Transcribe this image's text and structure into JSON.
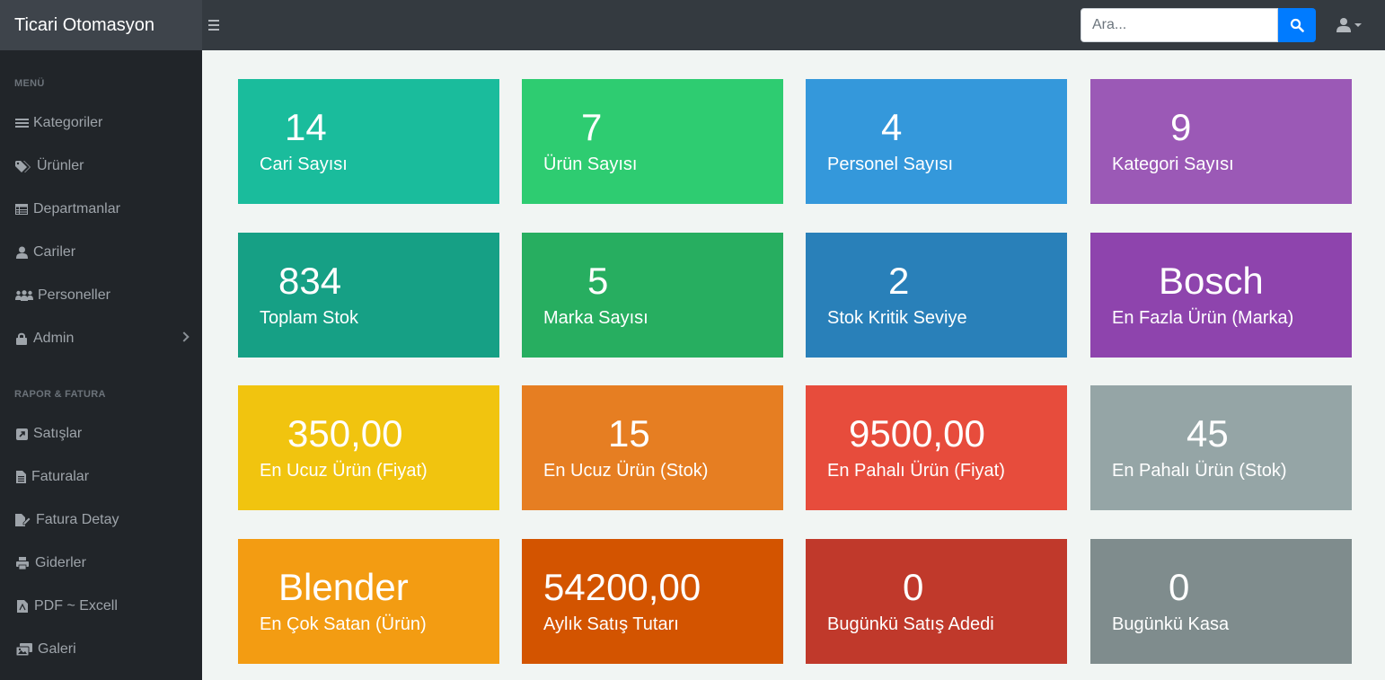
{
  "app": {
    "title": "Ticari Otomasyon"
  },
  "search": {
    "placeholder": "Ara..."
  },
  "icons": {
    "menu_toggle": "bars-icon",
    "search": "search-icon",
    "user": "user-icon"
  },
  "sidebar": {
    "sections": [
      {
        "heading": "MENÜ",
        "items": [
          {
            "label": "Kategoriler",
            "icon": "list-icon"
          },
          {
            "label": "Ürünler",
            "icon": "tags-icon"
          },
          {
            "label": "Departmanlar",
            "icon": "table-icon"
          },
          {
            "label": "Cariler",
            "icon": "user-icon"
          },
          {
            "label": "Personeller",
            "icon": "users-icon"
          },
          {
            "label": "Admin",
            "icon": "lock-icon",
            "has_submenu": true
          }
        ]
      },
      {
        "heading": "RAPOR & FATURA",
        "items": [
          {
            "label": "Satışlar",
            "icon": "external-link-icon"
          },
          {
            "label": "Faturalar",
            "icon": "file-text-icon"
          },
          {
            "label": "Fatura Detay",
            "icon": "edit-file-icon"
          },
          {
            "label": "Giderler",
            "icon": "print-icon"
          },
          {
            "label": "PDF ~ Excell",
            "icon": "pdf-file-icon"
          },
          {
            "label": "Galeri",
            "icon": "images-icon"
          }
        ]
      }
    ]
  },
  "cards": [
    {
      "value": "14",
      "label": "Cari Sayısı",
      "color": "#1abc9c"
    },
    {
      "value": "7",
      "label": "Ürün Sayısı",
      "color": "#2ecc71"
    },
    {
      "value": "4",
      "label": "Personel Sayısı",
      "color": "#3498db"
    },
    {
      "value": "9",
      "label": "Kategori Sayısı",
      "color": "#9b59b6"
    },
    {
      "value": "834",
      "label": "Toplam Stok",
      "color": "#16a085"
    },
    {
      "value": "5",
      "label": "Marka Sayısı",
      "color": "#27ae60"
    },
    {
      "value": "2",
      "label": "Stok Kritik Seviye",
      "color": "#2980b9"
    },
    {
      "value": "Bosch",
      "label": "En Fazla Ürün (Marka)",
      "color": "#8e44ad"
    },
    {
      "value": "350,00",
      "label": "En Ucuz Ürün (Fiyat)",
      "color": "#f1c40f"
    },
    {
      "value": "15",
      "label": "En Ucuz Ürün (Stok)",
      "color": "#e67e22"
    },
    {
      "value": "9500,00",
      "label": "En Pahalı Ürün (Fiyat)",
      "color": "#e74c3c"
    },
    {
      "value": "45",
      "label": "En Pahalı Ürün (Stok)",
      "color": "#95a5a6"
    },
    {
      "value": "Blender",
      "label": "En Çok Satan (Ürün)",
      "color": "#f39c12"
    },
    {
      "value": "54200,00",
      "label": "Aylık Satış Tutarı",
      "color": "#d35400"
    },
    {
      "value": "0",
      "label": "Bugünkü Satış Adedi",
      "color": "#c0392b"
    },
    {
      "value": "0",
      "label": "Bugünkü Kasa",
      "color": "#7f8c8d"
    }
  ]
}
